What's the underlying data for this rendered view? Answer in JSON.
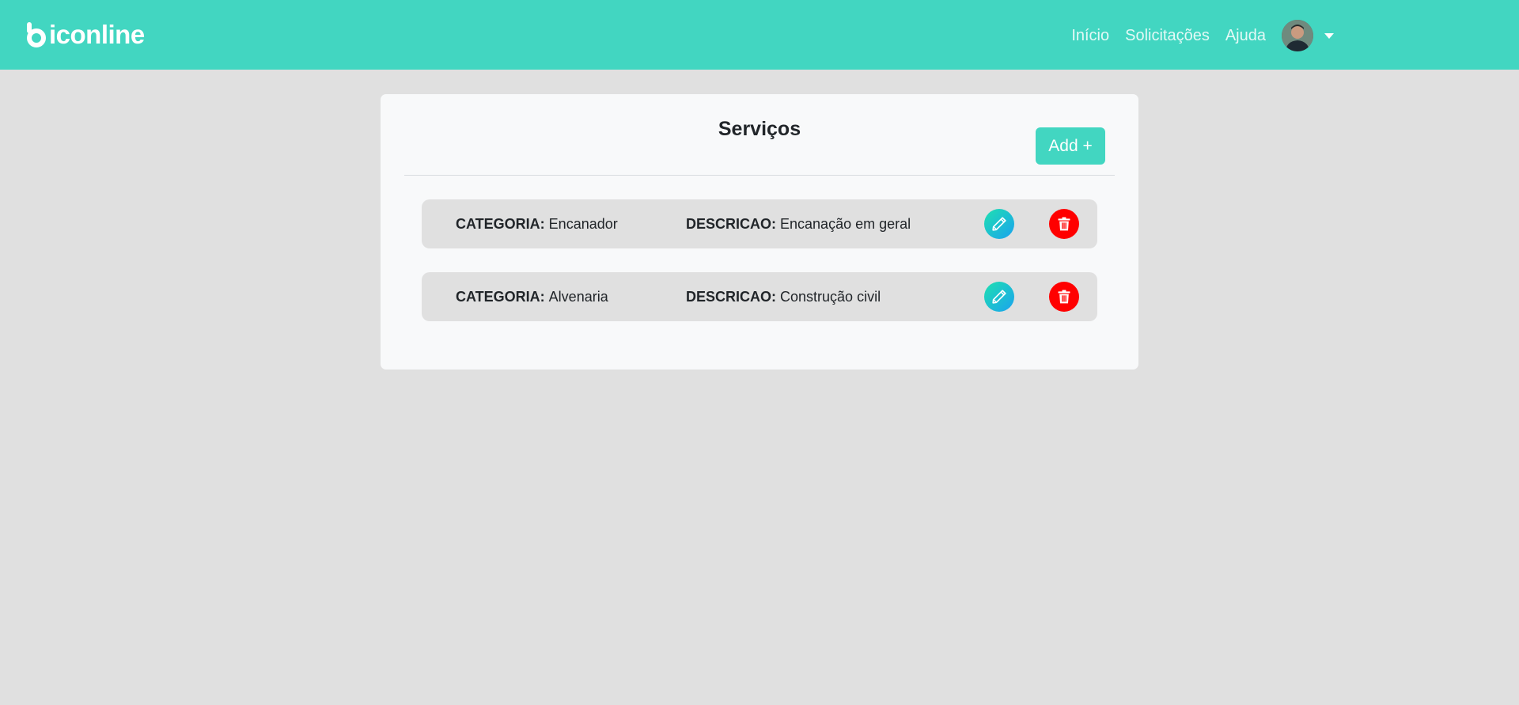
{
  "brand": {
    "name": "iconline"
  },
  "nav": {
    "links": [
      "Início",
      "Solicitações",
      "Ajuda"
    ]
  },
  "page": {
    "title": "Serviços",
    "add_label": "Add +"
  },
  "services": [
    {
      "categoria_label": "CATEGORIA:",
      "categoria": "Encanador",
      "descricao_label": "DESCRICAO:",
      "descricao": "Encanação em geral"
    },
    {
      "categoria_label": "CATEGORIA:",
      "categoria": "Alvenaria",
      "descricao_label": "DESCRICAO:",
      "descricao": "Construção civil"
    }
  ],
  "icons": {
    "edit": "pencil-icon",
    "delete": "trash-icon",
    "user_menu": "caret-down-icon"
  },
  "colors": {
    "accent": "#42d6c1",
    "delete": "#ff0000",
    "edit_gradient_start": "#1fe0b0",
    "edit_gradient_end": "#1aa2ef"
  }
}
